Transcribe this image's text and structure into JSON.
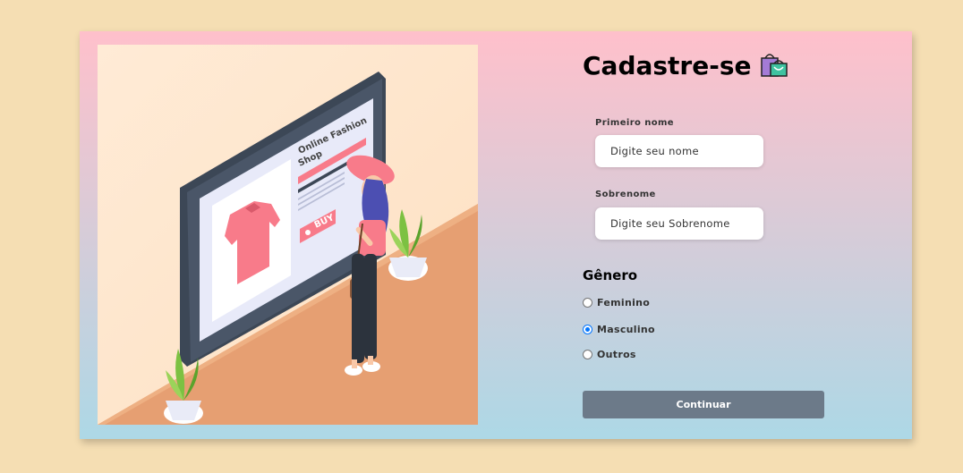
{
  "form": {
    "title": "Cadastre-se",
    "title_icon": "shopping-bags-icon",
    "first_name": {
      "label": "Primeiro nome",
      "placeholder": "Digite seu nome",
      "value": ""
    },
    "last_name": {
      "label": "Sobrenome",
      "placeholder": "Digite seu Sobrenome",
      "value": ""
    },
    "gender": {
      "title": "Gênero",
      "options": [
        {
          "label": "Feminino",
          "checked": false
        },
        {
          "label": "Masculino",
          "checked": true
        },
        {
          "label": "Outros",
          "checked": false
        }
      ]
    },
    "submit_label": "Continuar"
  },
  "illustration": {
    "screen_title": "Online Fashion Shop",
    "buy_label": "BUY"
  },
  "colors": {
    "page_bg": "#f5deb3",
    "card_gradient_top": "#ffc0cb",
    "card_gradient_bottom": "#add8e6",
    "button": "#6c7a89",
    "radio_accent": "#0075ff"
  }
}
